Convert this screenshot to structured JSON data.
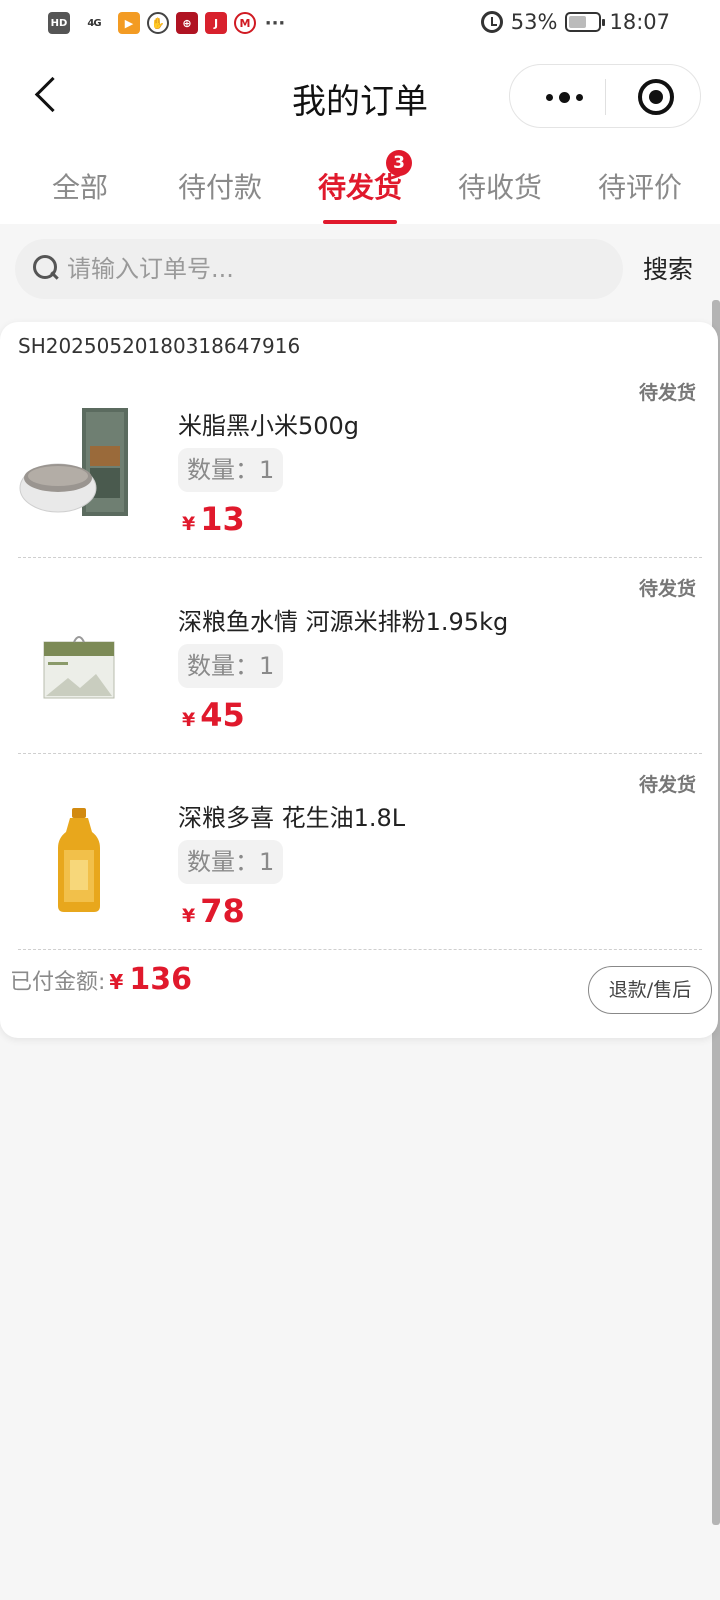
{
  "status_bar": {
    "hd": "HD",
    "signal": "4G",
    "battery_percent": "53%",
    "time": "18:07"
  },
  "nav": {
    "title": "我的订单"
  },
  "tabs": [
    {
      "label": "全部",
      "active": false
    },
    {
      "label": "待付款",
      "active": false
    },
    {
      "label": "待发货",
      "active": true,
      "badge": "3"
    },
    {
      "label": "待收货",
      "active": false
    },
    {
      "label": "待评价",
      "active": false
    }
  ],
  "search": {
    "placeholder": "请输入订单号...",
    "button": "搜索"
  },
  "order": {
    "id": "SH20250520180318647916",
    "items": [
      {
        "name": "米脂黑小米500g",
        "qty_label": "数量：",
        "qty": "1",
        "currency": "¥",
        "price": "13",
        "status": "待发货"
      },
      {
        "name": "深粮鱼水情 河源米排粉1.95kg",
        "qty_label": "数量：",
        "qty": "1",
        "currency": "¥",
        "price": "45",
        "status": "待发货"
      },
      {
        "name": "深粮多喜 花生油1.8L",
        "qty_label": "数量：",
        "qty": "1",
        "currency": "¥",
        "price": "78",
        "status": "待发货"
      }
    ],
    "paid_label": "已付金额:",
    "paid_currency": "¥",
    "paid_amount": "136",
    "refund_button": "退款/售后"
  },
  "colors": {
    "accent": "#e0192c",
    "background": "#f6f6f6"
  }
}
